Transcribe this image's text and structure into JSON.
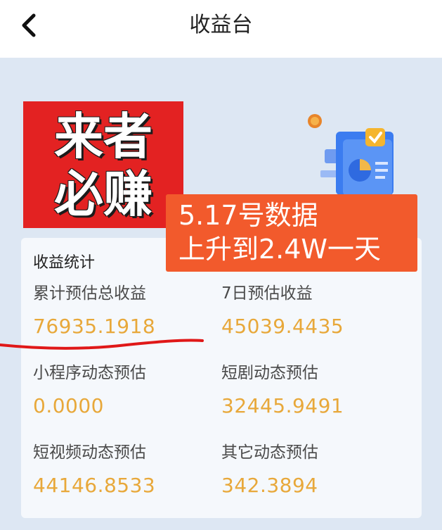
{
  "header": {
    "title": "收益台",
    "back_icon": "chevron-left-icon"
  },
  "promo": {
    "line1": "来者",
    "line2": "必赚",
    "background": "#e32222"
  },
  "notice": {
    "line1": "5.17号数据",
    "line2": "上升到2.4W一天",
    "background": "#f25a2c"
  },
  "illustration_icon": "document-chart-icon",
  "stats": {
    "title": "收益统计",
    "total_label": "累计预估总收益",
    "total_value": "76935.1918",
    "week_label": "7日预估收益",
    "week_value": "45039.4435",
    "miniprogram_label": "小程序动态预估",
    "miniprogram_value": "0.0000",
    "shortdrama_label": "短剧动态预估",
    "shortdrama_value": "32445.9491",
    "shortvideo_label": "短视频动态预估",
    "shortvideo_value": "44146.8533",
    "other_label": "其它动态预估",
    "other_value": "342.3894"
  },
  "colors": {
    "value": "#e8a83a",
    "page_bg": "#dde7f3",
    "card_bg": "#f5f8fc",
    "annotation_line": "#e01818"
  }
}
